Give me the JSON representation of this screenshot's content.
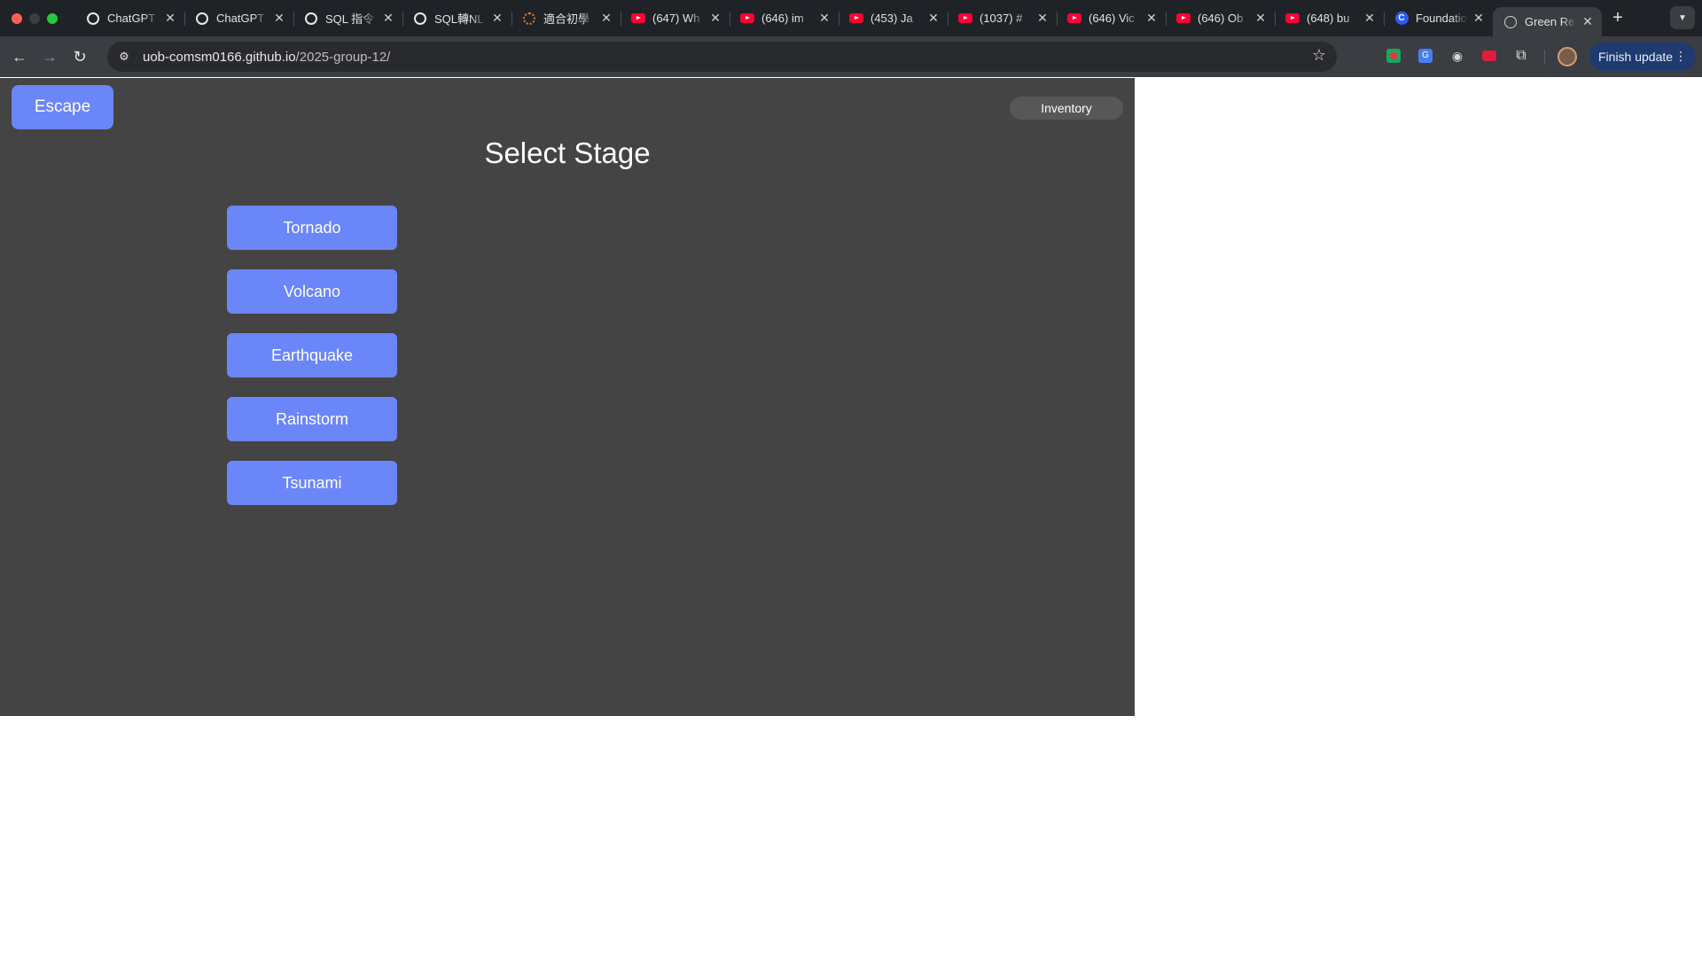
{
  "browser": {
    "tabs": [
      {
        "title": "ChatGPT",
        "favicon": "chatgpt-icon"
      },
      {
        "title": "ChatGPT",
        "favicon": "chatgpt-icon"
      },
      {
        "title": "SQL 指令",
        "favicon": "chatgpt-icon"
      },
      {
        "title": "SQL轉NL",
        "favicon": "chatgpt-icon"
      },
      {
        "title": "適合初學",
        "favicon": "dots-icon"
      },
      {
        "title": "(647) Wh",
        "favicon": "youtube-icon"
      },
      {
        "title": "(646) im",
        "favicon": "youtube-icon"
      },
      {
        "title": "(453) Ja",
        "favicon": "youtube-icon"
      },
      {
        "title": "(1037) #",
        "favicon": "youtube-icon"
      },
      {
        "title": "(646) Vic",
        "favicon": "youtube-icon"
      },
      {
        "title": "(646) Ob",
        "favicon": "youtube-icon"
      },
      {
        "title": "(648) bu",
        "favicon": "youtube-icon"
      },
      {
        "title": "Foundatio",
        "favicon": "c-icon"
      },
      {
        "title": "Green Re",
        "favicon": "globe-icon",
        "active": true
      }
    ],
    "url_host": "uob-comsm0166.github.io",
    "url_path": "/2025-group-12/",
    "update_label": "Finish update",
    "colors": {
      "tabbar": "#1f2227",
      "toolbar": "#3a3d42"
    }
  },
  "game": {
    "escape_label": "Escape",
    "inventory_label": "Inventory",
    "title": "Select Stage",
    "stages": [
      "Tornado",
      "Volcano",
      "Earthquake",
      "Rainstorm",
      "Tsunami"
    ],
    "colors": {
      "background": "#444444",
      "button": "#6b86f8"
    }
  }
}
